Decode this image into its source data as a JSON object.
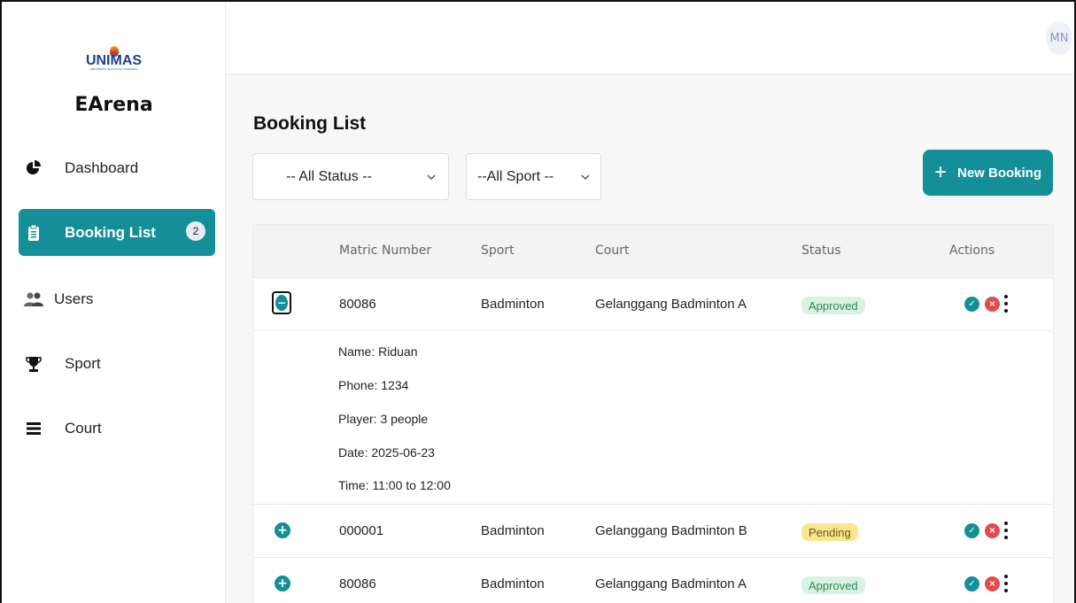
{
  "brand": {
    "logo_text": "UNIMAS",
    "logo_sub": "UNIVERSITI MALAYSIA SARAWAK",
    "app_name": "EArena"
  },
  "sidebar": {
    "items": [
      {
        "label": "Dashboard",
        "icon": "pie-chart-icon",
        "active": false
      },
      {
        "label": "Booking List",
        "icon": "clipboard-icon",
        "active": true,
        "badge": "2"
      },
      {
        "label": "Users",
        "icon": "users-icon",
        "active": false
      },
      {
        "label": "Sport",
        "icon": "trophy-icon",
        "active": false
      },
      {
        "label": "Court",
        "icon": "list-icon",
        "active": false
      }
    ]
  },
  "header": {
    "avatar_initials": "MN"
  },
  "page": {
    "title": "Booking List",
    "status_filter": "-- All Status --",
    "sport_filter": "--All Sport --",
    "new_booking_label": "New Booking"
  },
  "table": {
    "columns": [
      "Matric Number",
      "Sport",
      "Court",
      "Status",
      "Actions"
    ],
    "rows": [
      {
        "matric": "80086",
        "sport": "Badminton",
        "court": "Gelanggang Badminton A",
        "status": "Approved",
        "expanded": true,
        "details": [
          "Name: Riduan",
          "Phone: 1234",
          "Player: 3 people",
          "Date: 2025-06-23",
          "Time: 11:00 to 12:00"
        ]
      },
      {
        "matric": "000001",
        "sport": "Badminton",
        "court": "Gelanggang Badminton B",
        "status": "Pending",
        "expanded": false
      },
      {
        "matric": "80086",
        "sport": "Badminton",
        "court": "Gelanggang Badminton A",
        "status": "Approved",
        "expanded": false
      }
    ]
  },
  "colors": {
    "accent": "#148f98",
    "approved_bg": "#d8f2e3",
    "pending_bg": "#fbe68d",
    "reject": "#e14b4b"
  }
}
